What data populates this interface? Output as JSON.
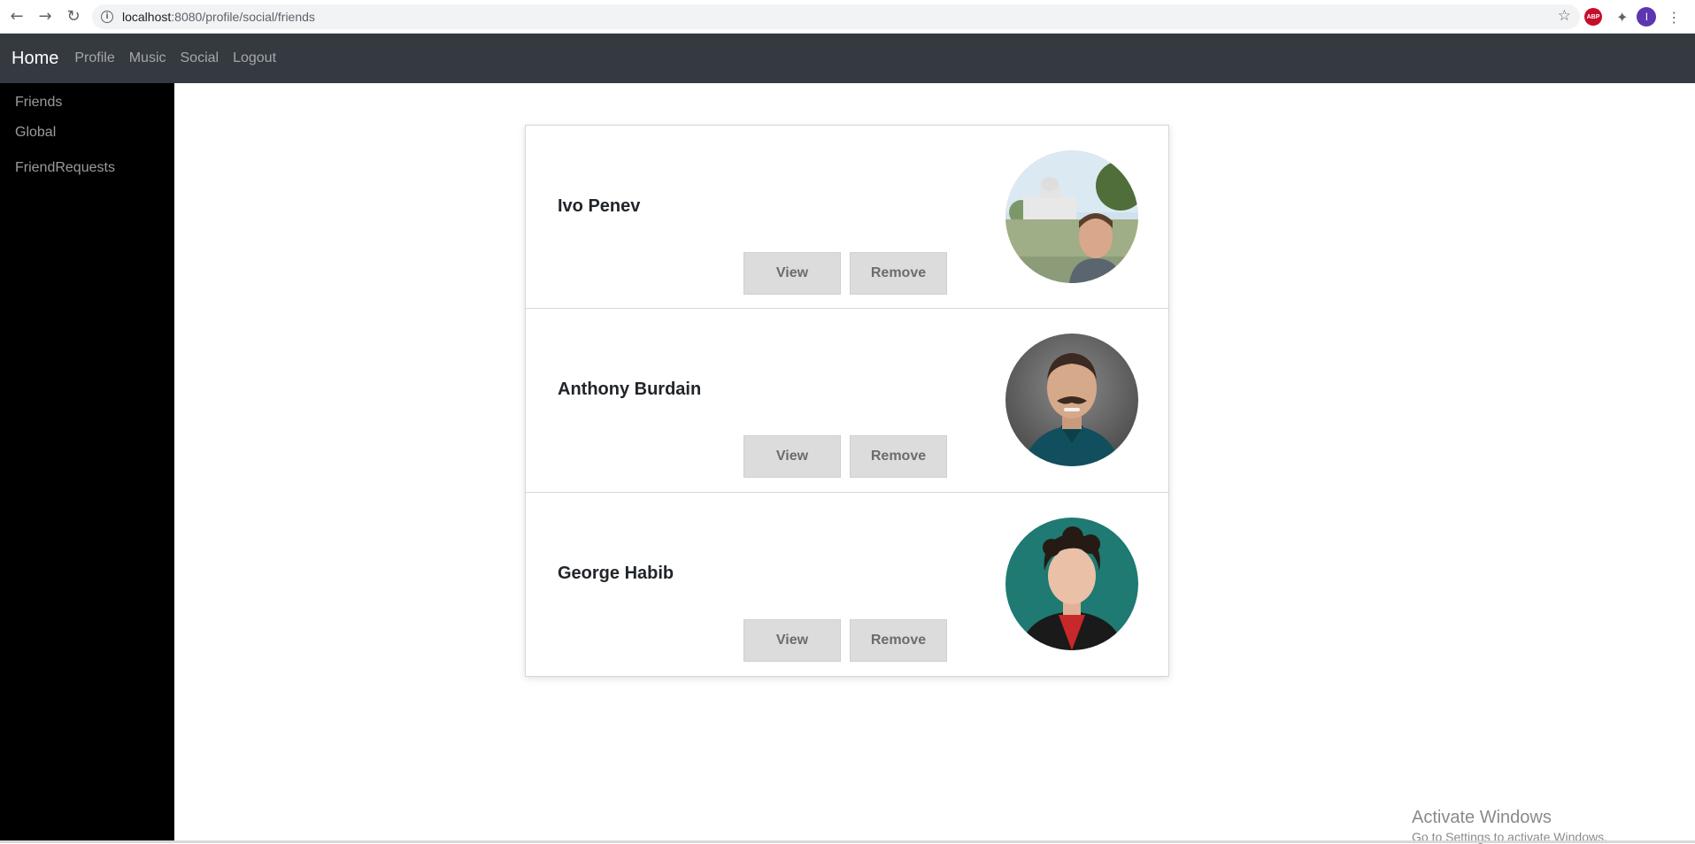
{
  "browser": {
    "url_host": "localhost",
    "url_path": ":8080/profile/social/friends",
    "profile_initial": "I",
    "abp_label": "ABP"
  },
  "navbar": {
    "brand": "Home",
    "links": [
      "Profile",
      "Music",
      "Social",
      "Logout"
    ]
  },
  "sidebar": {
    "items": [
      "Friends",
      "Global",
      "FriendRequests"
    ]
  },
  "friends": [
    {
      "name": "Ivo Penev",
      "view_label": "View",
      "remove_label": "Remove"
    },
    {
      "name": "Anthony Burdain",
      "view_label": "View",
      "remove_label": "Remove"
    },
    {
      "name": "George Habib",
      "view_label": "View",
      "remove_label": "Remove"
    }
  ],
  "watermark": {
    "title": "Activate Windows",
    "subtitle": "Go to Settings to activate Windows."
  },
  "colors": {
    "navbar_bg": "#343a40",
    "sidebar_bg": "#000000",
    "button_bg": "#dcdcdc",
    "profile_avatar": "#5e35b1",
    "abp_red": "#c70d2c"
  }
}
